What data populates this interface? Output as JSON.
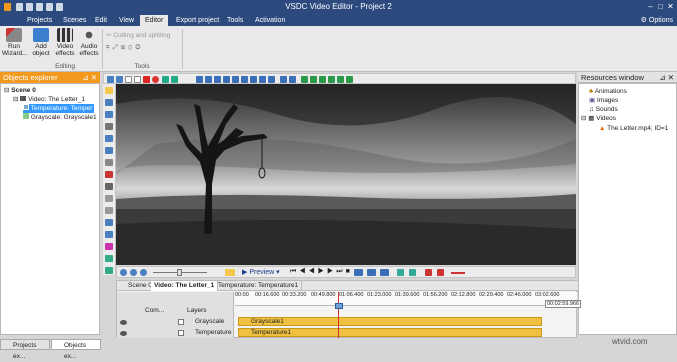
{
  "window": {
    "title": "VSDC Video Editor - Project 2",
    "close": "✕",
    "minimize": "–",
    "maximize": "□"
  },
  "menu": {
    "items": [
      "Projects",
      "Scenes",
      "Edit",
      "View",
      "Editor",
      "Export project",
      "Tools",
      "Activation"
    ],
    "active": "Editor",
    "options": "Options"
  },
  "ribbon": {
    "run_wizard": "Run Wizard...",
    "add_object": "Add object",
    "video_effects": "Video effects",
    "audio_effects": "Audio effects",
    "cutting_splitting": "Cutting and splitting",
    "group_editing": "Editing",
    "group_tools": "Tools"
  },
  "objects_explorer": {
    "title": "Objects explorer",
    "tree": [
      "Scene 0",
      "Video: The Letter_1",
      "Temperature: Temper",
      "Grayscale: Grayscale1"
    ]
  },
  "resources_window": {
    "title": "Resources window",
    "tree": [
      "Animations",
      "Images",
      "Sounds",
      "Videos",
      "The Letter.mp4; ID=1"
    ]
  },
  "transport": {
    "preview": "Preview"
  },
  "timeline": {
    "tabs": [
      "Scene 0",
      "Video: The Letter_1",
      "Temperature: Temperature1"
    ],
    "com_label": "Com...",
    "layers_label": "Layers",
    "rows": [
      {
        "name": "Grayscale",
        "clip": "Grayscale1"
      },
      {
        "name": "Temperature",
        "clip": "Temperature1"
      }
    ],
    "ticks": [
      "00:00",
      "00:16.600",
      "00:33.200",
      "00:49.800",
      "01:06.400",
      "01:23.000",
      "01:39.600",
      "01:56.200",
      "02:12.800",
      "02:29.400",
      "02:46.000",
      "03:02.600"
    ],
    "end_time": "00:02:59.966",
    "playhead_time": "01:06.400"
  },
  "bottom_tabs": [
    "Projects ex...",
    "Objects ex..."
  ],
  "watermark": "wtvid.com",
  "colors": {
    "titlebar": "#2c4a7e",
    "accent_orange": "#f39a1e",
    "clip": "#f0c040",
    "playhead": "#d03030"
  }
}
